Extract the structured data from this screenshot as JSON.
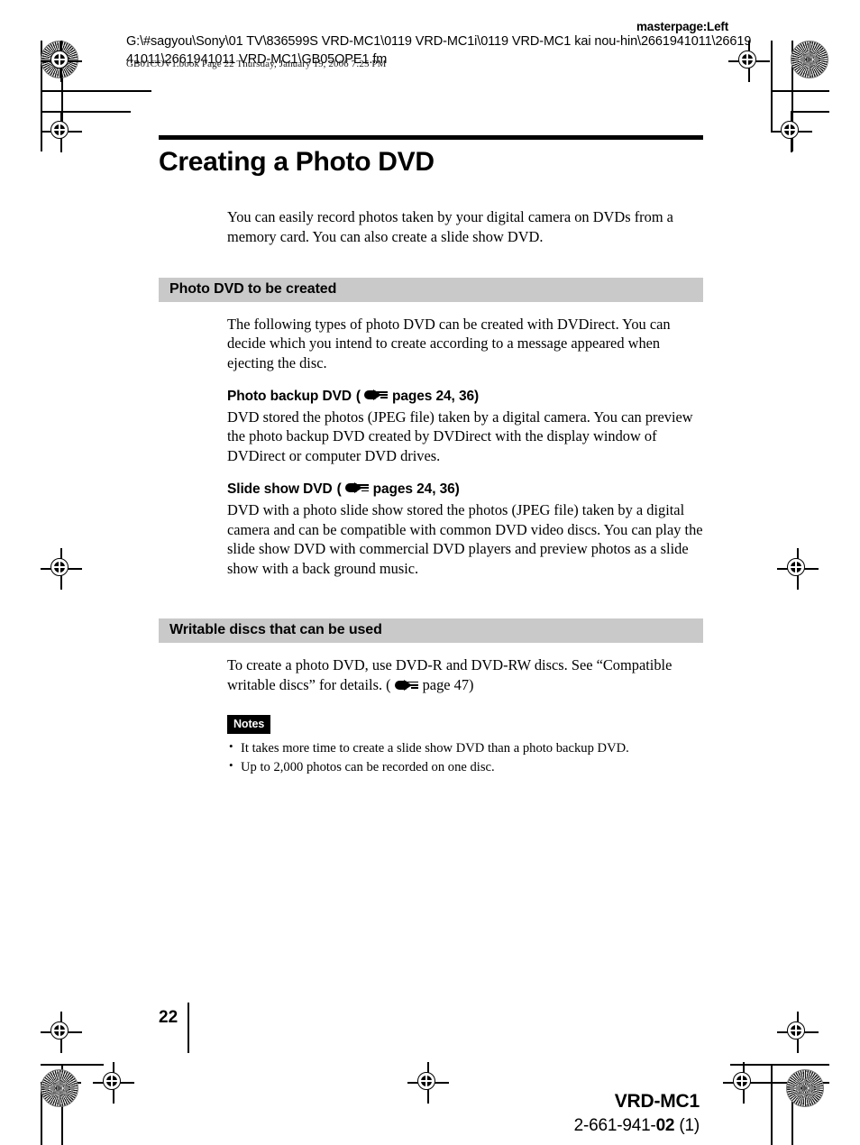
{
  "header": {
    "masterpage": "masterpage:Left",
    "file_path": "G:\\#sagyou\\Sony\\01 TV\\836599S VRD-MC1\\0119 VRD-MC1i\\0119 VRD-MC1 kai nou-hin\\2661941011\\2661941011\\2661941011 VRD-MC1\\GB05OPE1.fm",
    "book_line": "GB01COV1.book  Page 22  Thursday, January 19, 2006  7:25 PM"
  },
  "main": {
    "title": "Creating a Photo DVD",
    "intro": "You can easily record photos taken by your digital camera on DVDs from a memory card. You can also create a slide show DVD.",
    "sections": [
      {
        "heading": "Photo DVD to be created",
        "intro": "The following types of photo DVD can be created with DVDirect. You can decide which you intend to create according to a message appeared when ejecting the disc.",
        "subsections": [
          {
            "title": "Photo backup DVD",
            "ref_open": "(",
            "ref_text": "pages 24, 36)",
            "body": "DVD stored the photos (JPEG file) taken by a digital camera. You can preview the photo backup DVD created by DVDirect with the display window of DVDirect or computer DVD drives."
          },
          {
            "title": "Slide show DVD",
            "ref_open": "(",
            "ref_text": "pages 24, 36)",
            "body": "DVD with a photo slide show stored the photos (JPEG file) taken by a digital camera and can be compatible with common DVD video discs. You can play the slide show DVD with commercial DVD players and preview photos as a slide show with a back ground music."
          }
        ]
      },
      {
        "heading": "Writable discs that can be used",
        "body_part1": "To create a photo DVD, use DVD-R and DVD-RW discs. See “Compatible writable discs” for details. (",
        "body_part2": "page 47)"
      }
    ],
    "notes": {
      "label": "Notes",
      "items": [
        "It takes more time to create a slide show DVD than a photo backup DVD.",
        "Up to 2,000 photos can be recorded on one disc."
      ]
    }
  },
  "footer": {
    "page_number": "22",
    "model": "VRD-MC1",
    "part_number_prefix": "2-661-941-",
    "part_number_bold": "02",
    "part_number_suffix": " (1)"
  },
  "colors": {
    "section_bar": "#c9c9c9",
    "rule": "#000000",
    "page_background": "#ffffff"
  }
}
